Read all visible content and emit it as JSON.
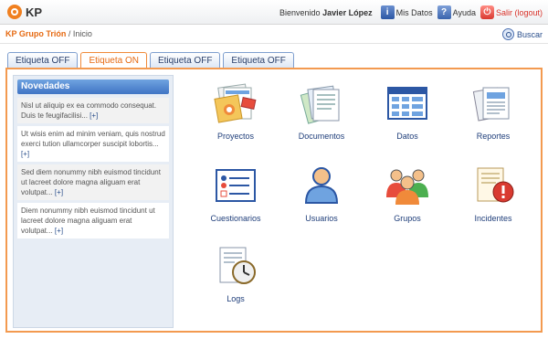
{
  "header": {
    "logo_text": "KP",
    "welcome_prefix": "Bienvenido",
    "user_name": "Javier López",
    "my_data_label": "Mis Datos",
    "help_label": "Ayuda",
    "exit_label": "Salir (logout)"
  },
  "breadcrumb": {
    "group": "KP Grupo Trión",
    "separator": "/",
    "current": "Inicio"
  },
  "search_label": "Buscar",
  "tabs": [
    {
      "label": "Etiqueta OFF"
    },
    {
      "label": "Etiqueta ON"
    },
    {
      "label": "Etiqueta OFF"
    },
    {
      "label": "Etiqueta OFF"
    }
  ],
  "sidebar": {
    "title": "Novedades",
    "items": [
      {
        "text": "Nisl ut aliquip ex ea commodo consequat. Duis te feugifacilisi...",
        "more": "[+]"
      },
      {
        "text": "Ut wisis enim ad minim veniam, quis nostrud exerci tution ullamcorper suscipit lobortis...",
        "more": "[+]"
      },
      {
        "text": "Sed diem nonummy nibh euismod tincidunt ut lacreet dolore magna aliguam erat volutpat...",
        "more": "[+]"
      },
      {
        "text": "Diem nonummy nibh euismod tincidunt ut lacreet dolore magna aliguam erat volutpat...",
        "more": "[+]"
      }
    ]
  },
  "apps": [
    {
      "label": "Proyectos",
      "icon": "projects-icon"
    },
    {
      "label": "Documentos",
      "icon": "documents-icon"
    },
    {
      "label": "Datos",
      "icon": "data-icon"
    },
    {
      "label": "Reportes",
      "icon": "reports-icon"
    },
    {
      "label": "Cuestionarios",
      "icon": "questionnaire-icon"
    },
    {
      "label": "Usuarios",
      "icon": "user-icon"
    },
    {
      "label": "Grupos",
      "icon": "groups-icon"
    },
    {
      "label": "Incidentes",
      "icon": "incidents-icon"
    },
    {
      "label": "Logs",
      "icon": "logs-icon"
    }
  ],
  "colors": {
    "accent_orange": "#f08a3a",
    "link_blue": "#1f3e7a",
    "exit_red": "#d9332a"
  }
}
